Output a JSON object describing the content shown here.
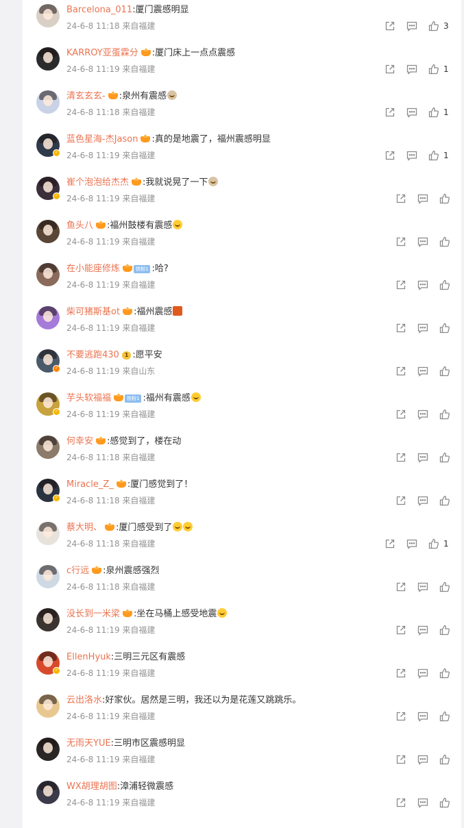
{
  "comments": [
    {
      "name": "Barcelona_011",
      "badges": [],
      "text": ":厦门震感明显",
      "emojis": [],
      "time": "24-6-8 11:18 来自福建",
      "likes": "3",
      "avatar_color": "#d9cfc4",
      "vbadge": ""
    },
    {
      "name": "KARROY亚蛋霖分",
      "badges": [
        "vip"
      ],
      "text": ":厦门床上一点点震感",
      "emojis": [],
      "time": "24-6-8 11:19 来自福建",
      "likes": "1",
      "avatar_color": "#2b2b2b",
      "vbadge": ""
    },
    {
      "name": "清玄玄玄-",
      "badges": [
        "vip"
      ],
      "text": ":泉州有震感",
      "emojis": [
        "person"
      ],
      "time": "24-6-8 11:18 来自福建",
      "likes": "1",
      "avatar_color": "#c9d2e6",
      "vbadge": ""
    },
    {
      "name": "蓝色星海-杰Jason",
      "badges": [
        "vip"
      ],
      "text": ":真的是地震了，福州震感明显",
      "emojis": [],
      "time": "24-6-8 11:19 来自福建",
      "likes": "1",
      "avatar_color": "#2f3a4a",
      "vbadge": "gold"
    },
    {
      "name": "崔个泡泡给杰杰",
      "badges": [
        "vip"
      ],
      "text": ":我就说晃了一下",
      "emojis": [
        "person"
      ],
      "time": "24-6-8 11:19 来自福建",
      "likes": "",
      "avatar_color": "#3a2f3a",
      "vbadge": "gold"
    },
    {
      "name": "鱼头八",
      "badges": [
        "vip"
      ],
      "text": ":福州鼓楼有震感",
      "emojis": [
        "face"
      ],
      "time": "24-6-8 11:19 来自福建",
      "likes": "",
      "avatar_color": "#5a4636",
      "vbadge": ""
    },
    {
      "name": "在小能座修炼",
      "badges": [
        "vip",
        "fan"
      ],
      "text": ":哈?",
      "emojis": [],
      "time": "24-6-8 11:19 来自福建",
      "likes": "",
      "avatar_color": "#8a6a5a",
      "vbadge": ""
    },
    {
      "name": "柴可猪斯基ot",
      "badges": [
        "vip"
      ],
      "text": ":福州震感",
      "emojis": [
        "square"
      ],
      "time": "24-6-8 11:19 来自福建",
      "likes": "",
      "avatar_color": "#a57bd9",
      "vbadge": ""
    },
    {
      "name": "不要逃跑430",
      "badges": [
        "crown"
      ],
      "text": ":愿平安",
      "emojis": [],
      "time": "24-6-8 11:19 来自山东",
      "likes": "",
      "avatar_color": "#4a5a6a",
      "vbadge": "orange"
    },
    {
      "name": "芋头软福福",
      "badges": [
        "vip",
        "fan"
      ],
      "text": ":福州有震感",
      "emojis": [
        "face"
      ],
      "time": "24-6-8 11:19 来自福建",
      "likes": "",
      "avatar_color": "#c8a23c",
      "vbadge": "gold"
    },
    {
      "name": "何幸安",
      "badges": [
        "vip"
      ],
      "text": ":感觉到了，楼在动",
      "emojis": [],
      "time": "24-6-8 11:18 来自福建",
      "likes": "",
      "avatar_color": "#8c7a6a",
      "vbadge": ""
    },
    {
      "name": "Miracle_Z_",
      "badges": [
        "vip"
      ],
      "text": ":厦门感觉到了！",
      "emojis": [],
      "time": "24-6-8 11:18 来自福建",
      "likes": "",
      "avatar_color": "#2a3340",
      "vbadge": "gold"
    },
    {
      "name": "蔡大明、",
      "badges": [
        "vip"
      ],
      "text": ":厦门感受到了",
      "emojis": [
        "face",
        "face"
      ],
      "time": "24-6-8 11:18 来自福建",
      "likes": "1",
      "avatar_color": "#e8e2dc",
      "vbadge": ""
    },
    {
      "name": "c行远",
      "badges": [
        "vip"
      ],
      "text": ":泉州震感强烈",
      "emojis": [],
      "time": "24-6-8 11:18 来自福建",
      "likes": "",
      "avatar_color": "#cfd9e3",
      "vbadge": ""
    },
    {
      "name": "没长到一米梁",
      "badges": [
        "vip"
      ],
      "text": ":坐在马桶上感受地震",
      "emojis": [
        "face"
      ],
      "time": "24-6-8 11:19 来自福建",
      "likes": "",
      "avatar_color": "#3b3330",
      "vbadge": ""
    },
    {
      "name": "EllenHyuk",
      "badges": [],
      "text": ":三明三元区有震感",
      "emojis": [],
      "time": "24-6-8 11:19 来自福建",
      "likes": "",
      "avatar_color": "#d8492c",
      "vbadge": "gold"
    },
    {
      "name": "云出洛水",
      "badges": [],
      "text": ":好家伙。居然是三明，我还以为是花莲又跳跳乐。",
      "emojis": [],
      "time": "24-6-8 11:19 来自福建",
      "likes": "",
      "avatar_color": "#e8c890",
      "vbadge": ""
    },
    {
      "name": "无雨天YUE",
      "badges": [],
      "text": ":三明市区震感明显",
      "emojis": [],
      "time": "24-6-8 11:19 来自福建",
      "likes": "",
      "avatar_color": "#2a2626",
      "vbadge": ""
    },
    {
      "name": "WX胡理胡图",
      "badges": [],
      "text": ":漳浦轻微震感",
      "emojis": [],
      "time": "24-6-8 11:19 来自福建",
      "likes": "",
      "avatar_color": "#3a3a4a",
      "vbadge": ""
    }
  ],
  "labels": {
    "fan": "铁粉1",
    "crown": "1"
  },
  "colors": {
    "name": "#eb7350",
    "meta": "#939393",
    "icon": "#8a8a8a"
  }
}
